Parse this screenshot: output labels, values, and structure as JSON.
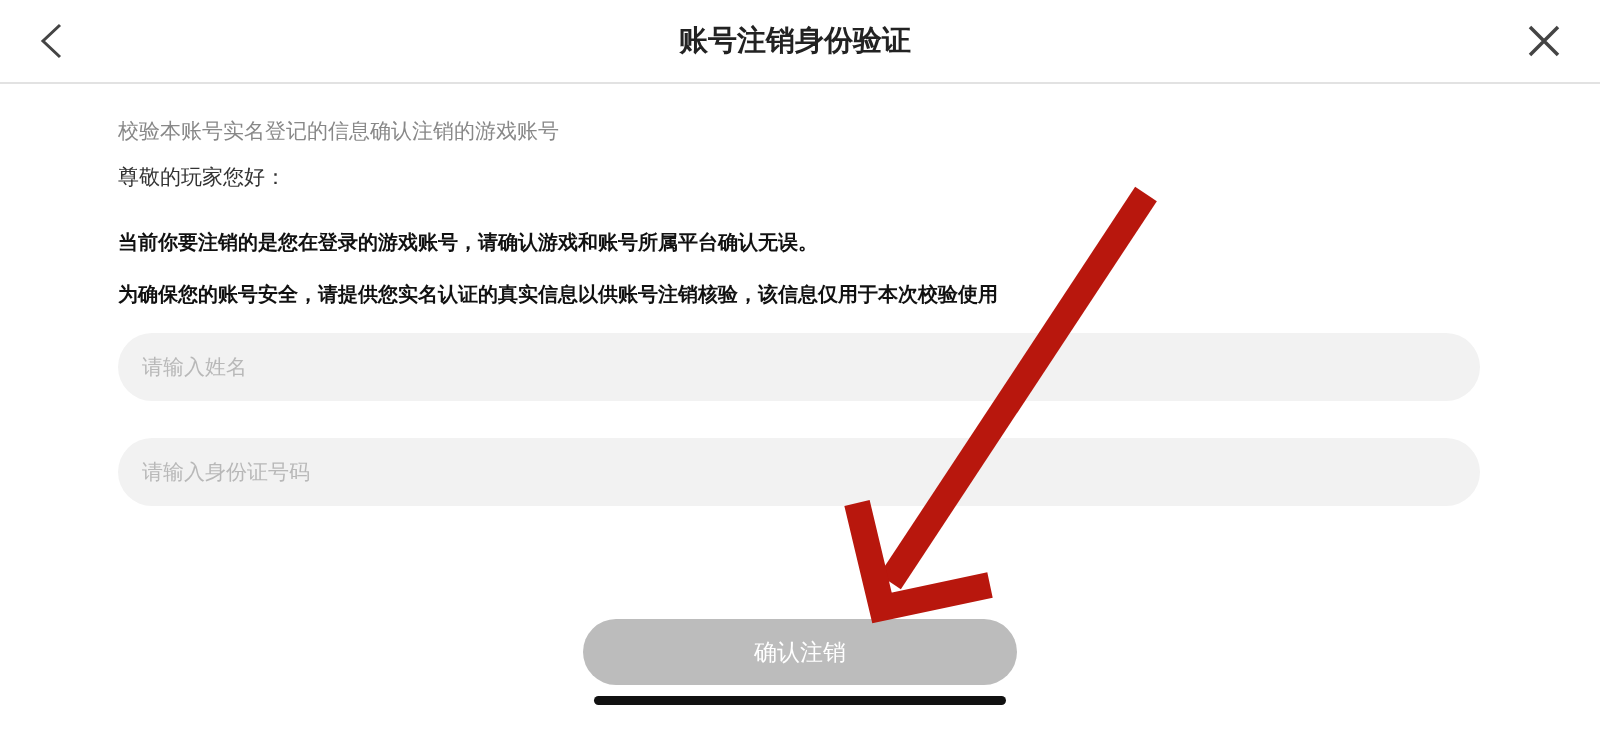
{
  "header": {
    "title": "账号注销身份验证"
  },
  "subtitle": "校验本账号实名登记的信息确认注销的游戏账号",
  "greeting": "尊敬的玩家您好：",
  "notices": [
    "当前你要注销的是您在登录的游戏账号，请确认游戏和账号所属平台确认无误。",
    "为确保您的账号安全，请提供您实名认证的真实信息以供账号注销核验，该信息仅用于本次校验使用"
  ],
  "fields": [
    {
      "placeholder": "请输入姓名"
    },
    {
      "placeholder": "请输入身份证号码"
    }
  ],
  "submit": {
    "label": "确认注销",
    "disabled": true
  }
}
